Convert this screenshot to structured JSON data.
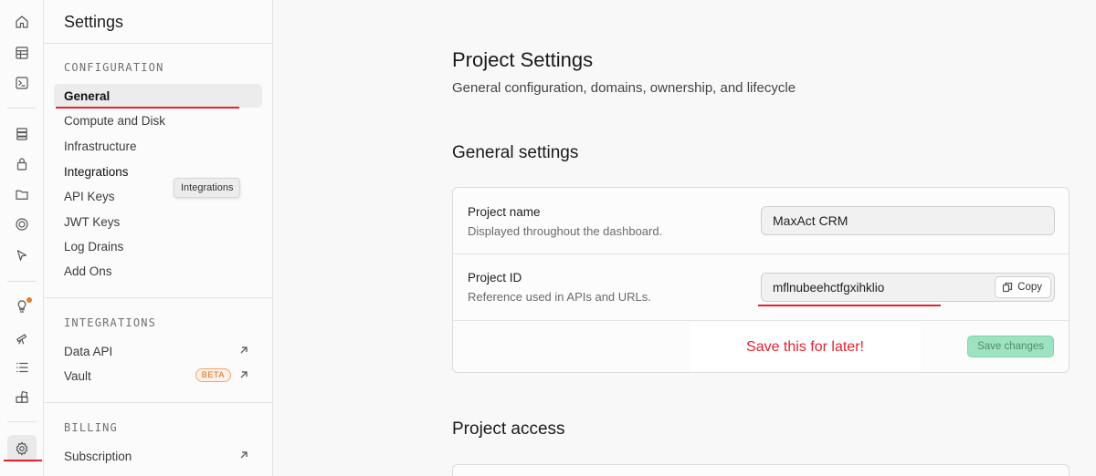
{
  "rail": {
    "icons": [
      "home-icon",
      "table-editor-icon",
      "sql-editor-icon",
      "database-icon",
      "auth-icon",
      "storage-icon",
      "realtime-icon",
      "edge-functions-icon",
      "advisors-icon",
      "reports-icon",
      "logs-icon",
      "integrations-icon",
      "settings-icon"
    ],
    "notification_color": "#e0802f"
  },
  "sidebar": {
    "title": "Settings",
    "sections": [
      {
        "label": "CONFIGURATION",
        "items": [
          {
            "label": "General",
            "active": true
          },
          {
            "label": "Compute and Disk"
          },
          {
            "label": "Infrastructure"
          },
          {
            "label": "Integrations"
          },
          {
            "label": "API Keys"
          },
          {
            "label": "JWT Keys"
          },
          {
            "label": "Log Drains"
          },
          {
            "label": "Add Ons"
          }
        ]
      },
      {
        "label": "INTEGRATIONS",
        "items": [
          {
            "label": "Data API",
            "external": true
          },
          {
            "label": "Vault",
            "badge": "BETA",
            "external": true
          }
        ]
      },
      {
        "label": "BILLING",
        "items": [
          {
            "label": "Subscription",
            "external": true
          }
        ]
      }
    ],
    "tooltip": "Integrations"
  },
  "main": {
    "title": "Project Settings",
    "subtitle": "General configuration, domains, ownership, and lifecycle",
    "general_title": "General settings",
    "project_name": {
      "label": "Project name",
      "help": "Displayed throughout the dashboard.",
      "value": "MaxAct CRM"
    },
    "project_id": {
      "label": "Project ID",
      "help": "Reference used in APIs and URLs.",
      "value": "mflnubeehctfgxihklio",
      "copy_label": "Copy"
    },
    "save_label": "Save changes",
    "access_title": "Project access"
  },
  "annotation": {
    "callout": "Save this for later!",
    "color": "#e5222e"
  }
}
